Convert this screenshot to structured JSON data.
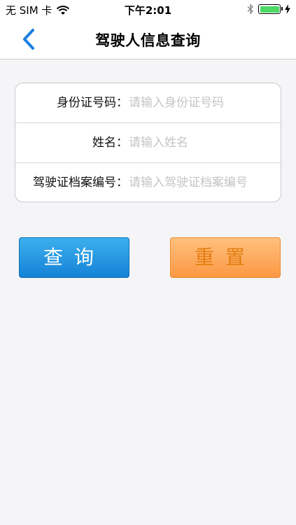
{
  "status_bar": {
    "carrier": "无 SIM 卡",
    "time": "下午2:01",
    "wifi_icon": "wifi-icon",
    "bluetooth_icon": "bluetooth-icon",
    "battery_icon": "battery-icon",
    "battery_level": 1.0,
    "battery_color": "#4cd964"
  },
  "nav": {
    "title": "驾驶人信息查询",
    "back_icon": "chevron-left-icon",
    "accent_color": "#1a7fe0"
  },
  "form": {
    "id_number": {
      "label": "身份证号码：",
      "placeholder": "请输入身份证号码",
      "value": ""
    },
    "name": {
      "label": "姓名：",
      "placeholder": "请输入姓名",
      "value": ""
    },
    "license_file_number": {
      "label": "驾驶证档案编号：",
      "placeholder": "请输入驾驶证档案编号",
      "value": ""
    }
  },
  "buttons": {
    "query_label": "查询",
    "query_color": "#1e8fe0",
    "reset_label": "重置",
    "reset_color": "#fba04e"
  }
}
